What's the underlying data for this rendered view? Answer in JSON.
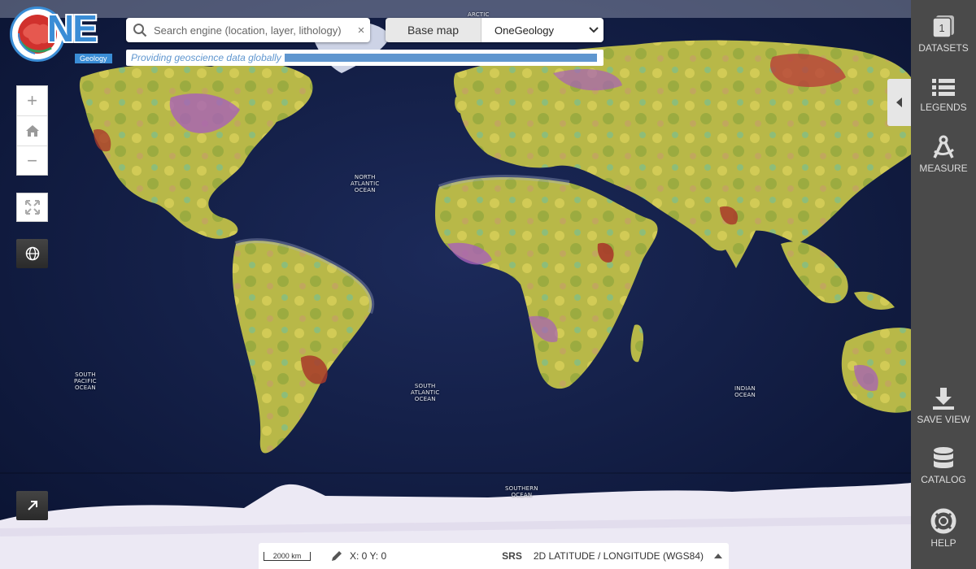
{
  "logo": {
    "text": "NE",
    "subtext": "Geology"
  },
  "search": {
    "placeholder": "Search engine (location, layer, lithology)",
    "clear": "×"
  },
  "tagline": "Providing geoscience data globally",
  "basemap": {
    "label": "Base map",
    "selected": "OneGeology"
  },
  "map_controls": {
    "zoom_in": "+",
    "zoom_out": "−"
  },
  "ocean_labels": {
    "arctic": "ARCTIC",
    "north_atlantic": [
      "NORTH",
      "ATLANTIC",
      "OCEAN"
    ],
    "south_pacific": [
      "SOUTH",
      "PACIFIC",
      "OCEAN"
    ],
    "south_atlantic": [
      "SOUTH",
      "ATLANTIC",
      "OCEAN"
    ],
    "indian": [
      "INDIAN",
      "OCEAN"
    ],
    "southern": [
      "SOUTHERN",
      "OCEAN"
    ]
  },
  "side_panel": {
    "datasets_count": "1",
    "datasets": "DATASETS",
    "legends": "LEGENDS",
    "measure": "MEASURE",
    "save_view": "SAVE VIEW",
    "catalog": "CATALOG",
    "help": "HELP"
  },
  "bottom_bar": {
    "scale": "2000 km",
    "coords": "X: 0 Y: 0",
    "srs_label": "SRS",
    "srs_value": "2D LATITUDE / LONGITUDE (WGS84)"
  },
  "colors": {
    "accent": "#3a8dd6",
    "panel": "#4a4a4a",
    "ocean": "#0f1a3c"
  }
}
